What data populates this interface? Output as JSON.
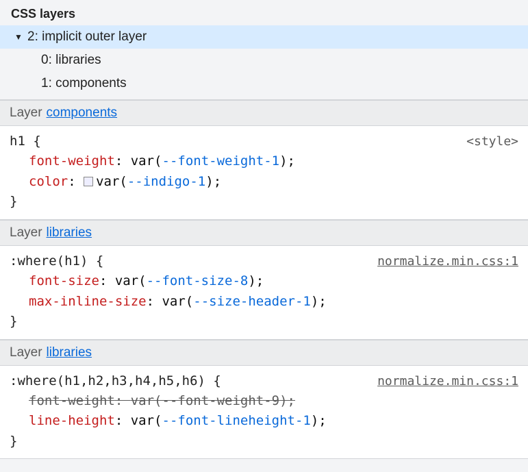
{
  "title": "CSS layers",
  "tree": {
    "root": "2: implicit outer layer",
    "children": [
      "0: libraries",
      "1: components"
    ]
  },
  "layerWord": "Layer",
  "blocks": [
    {
      "layer": "components",
      "selector": "h1 {",
      "source": "<style>",
      "sourceLinked": false,
      "decls": [
        {
          "prop": "font-weight",
          "val": "var(",
          "var": "--font-weight-1",
          "tail": ");",
          "strike": false,
          "swatch": false
        },
        {
          "prop": "color",
          "val": "var(",
          "var": "--indigo-1",
          "tail": ");",
          "strike": false,
          "swatch": true
        }
      ],
      "close": "}"
    },
    {
      "layer": "libraries",
      "selector": ":where(h1) {",
      "source": "normalize.min.css:1",
      "sourceLinked": true,
      "decls": [
        {
          "prop": "font-size",
          "val": "var(",
          "var": "--font-size-8",
          "tail": ");",
          "strike": false,
          "swatch": false
        },
        {
          "prop": "max-inline-size",
          "val": "var(",
          "var": "--size-header-1",
          "tail": ");",
          "strike": false,
          "swatch": false
        }
      ],
      "close": "}"
    },
    {
      "layer": "libraries",
      "selector": ":where(h1,h2,h3,h4,h5,h6) {",
      "source": "normalize.min.css:1",
      "sourceLinked": true,
      "decls": [
        {
          "prop": "font-weight",
          "val": "var(",
          "var": "--font-weight-9",
          "tail": ");",
          "strike": true,
          "swatch": false
        },
        {
          "prop": "line-height",
          "val": "var(",
          "var": "--font-lineheight-1",
          "tail": ");",
          "strike": false,
          "swatch": false
        }
      ],
      "close": "}"
    }
  ]
}
